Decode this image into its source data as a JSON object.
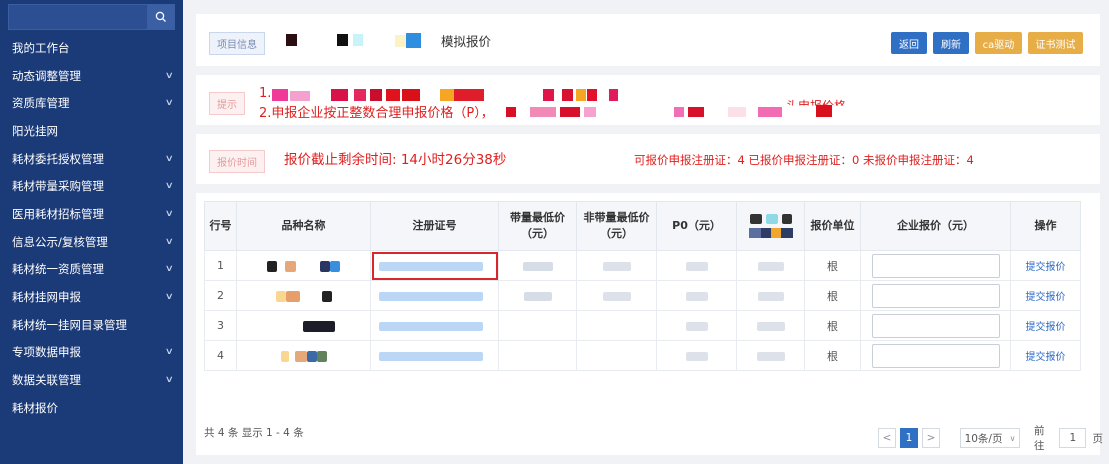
{
  "sidebar": {
    "items": [
      {
        "label": "我的工作台",
        "chevron": false
      },
      {
        "label": "动态调整管理",
        "chevron": true
      },
      {
        "label": "资质库管理",
        "chevron": true
      },
      {
        "label": "阳光挂网",
        "chevron": false
      },
      {
        "label": "耗材委托授权管理",
        "chevron": true
      },
      {
        "label": "耗材带量采购管理",
        "chevron": true
      },
      {
        "label": "医用耗材招标管理",
        "chevron": true
      },
      {
        "label": "信息公示/复核管理",
        "chevron": true
      },
      {
        "label": "耗材统一资质管理",
        "chevron": true
      },
      {
        "label": "耗材挂网申报",
        "chevron": true
      },
      {
        "label": "耗材统一挂网目录管理",
        "chevron": false
      },
      {
        "label": "专项数据申报",
        "chevron": true
      },
      {
        "label": "数据关联管理",
        "chevron": true
      },
      {
        "label": "耗材报价",
        "chevron": false
      }
    ]
  },
  "project": {
    "tag": "项目信息",
    "title": "模拟报价"
  },
  "buttons": {
    "back": "返回",
    "refresh": "刷新",
    "ca_driver": "ca驱动",
    "cert_test": "证书测试"
  },
  "notice": {
    "tag": "提示",
    "line1": "1.",
    "line2": "2.申报企业按正整数合理申报价格（P），",
    "line2_tail": "头申报价格"
  },
  "deadline": {
    "tag": "报价时间",
    "text": "报价截止剩余时间: 14小时26分38秒",
    "stats": "可报价申报注册证：4 已报价申报注册证：0 未报价申报注册证：4"
  },
  "table": {
    "headers": [
      "行号",
      "品种名称",
      "注册证号",
      "带量最低价（元）",
      "非带量最低价（元）",
      "P0（元）",
      "",
      "报价单位",
      "企业报价（元）",
      "操作"
    ],
    "rows": [
      {
        "no": "1",
        "unit": "根",
        "action": "提交报价"
      },
      {
        "no": "2",
        "unit": "根",
        "action": "提交报价"
      },
      {
        "no": "3",
        "unit": "根",
        "action": "提交报价"
      },
      {
        "no": "4",
        "unit": "根",
        "action": "提交报价"
      }
    ]
  },
  "footer": {
    "summary": "共 4 条  显示 1 - 4 条",
    "prev": "<",
    "page": "1",
    "next": ">",
    "page_size": "10条/页",
    "goto_label": "前往",
    "goto_value": "1",
    "page_suffix": "页"
  },
  "colors": {
    "sidebar_bg": "#1b3a78",
    "primary_button": "#2f6fc4",
    "warning_button": "#e7ae47",
    "alert_text": "#e01f1f",
    "highlight_border": "#d9262a"
  }
}
